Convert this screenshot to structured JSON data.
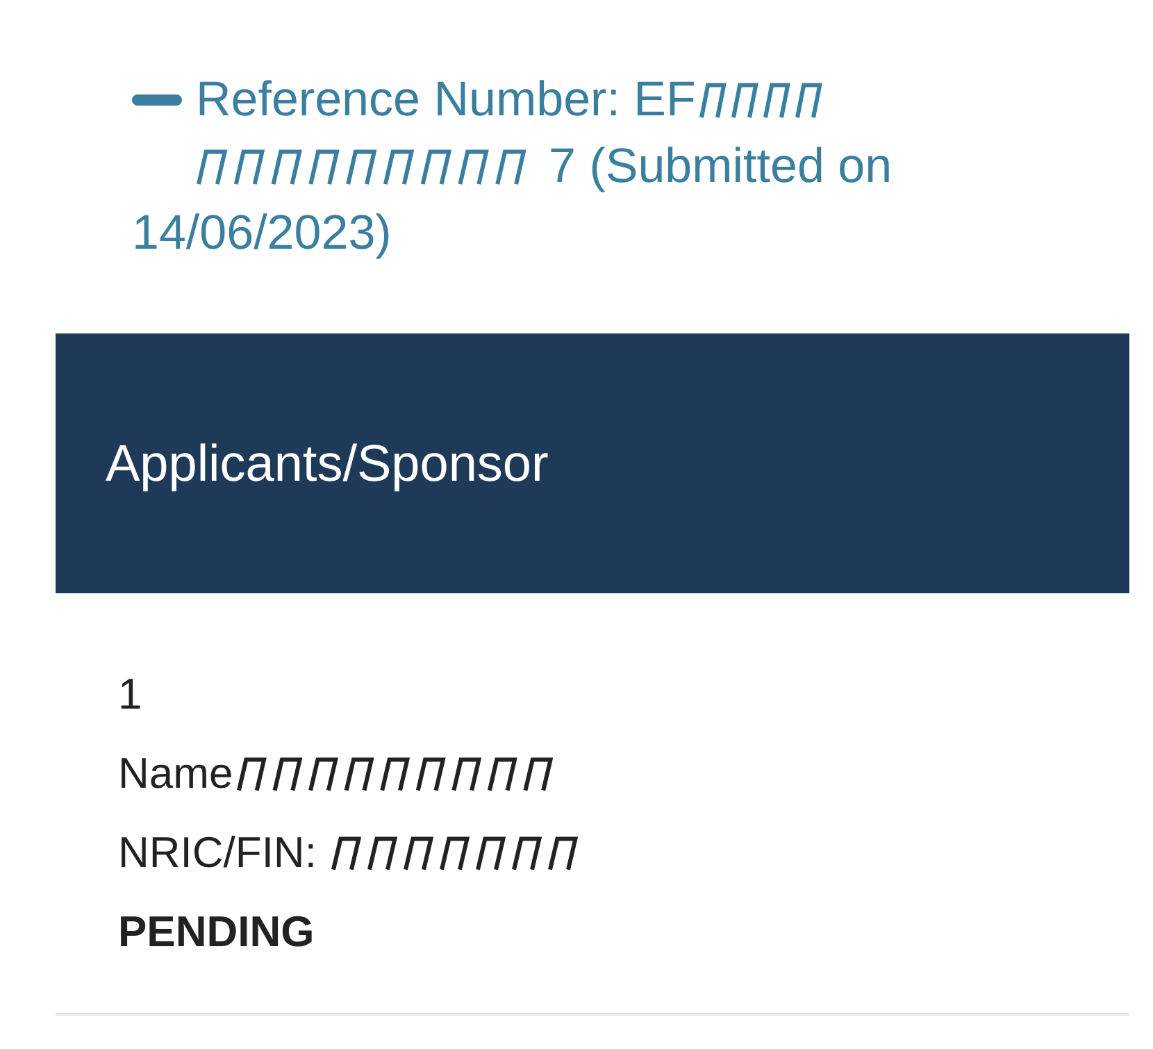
{
  "reference": {
    "prefix": "Reference Number: EF",
    "suffix": "7 (Submitted on",
    "date": "14/06/2023)"
  },
  "section": {
    "title": "Applicants/Sponsor"
  },
  "applicants": [
    {
      "index": "1",
      "name_label": "Name",
      "nric_label": "NRIC/FIN:",
      "status": "PENDING"
    }
  ]
}
